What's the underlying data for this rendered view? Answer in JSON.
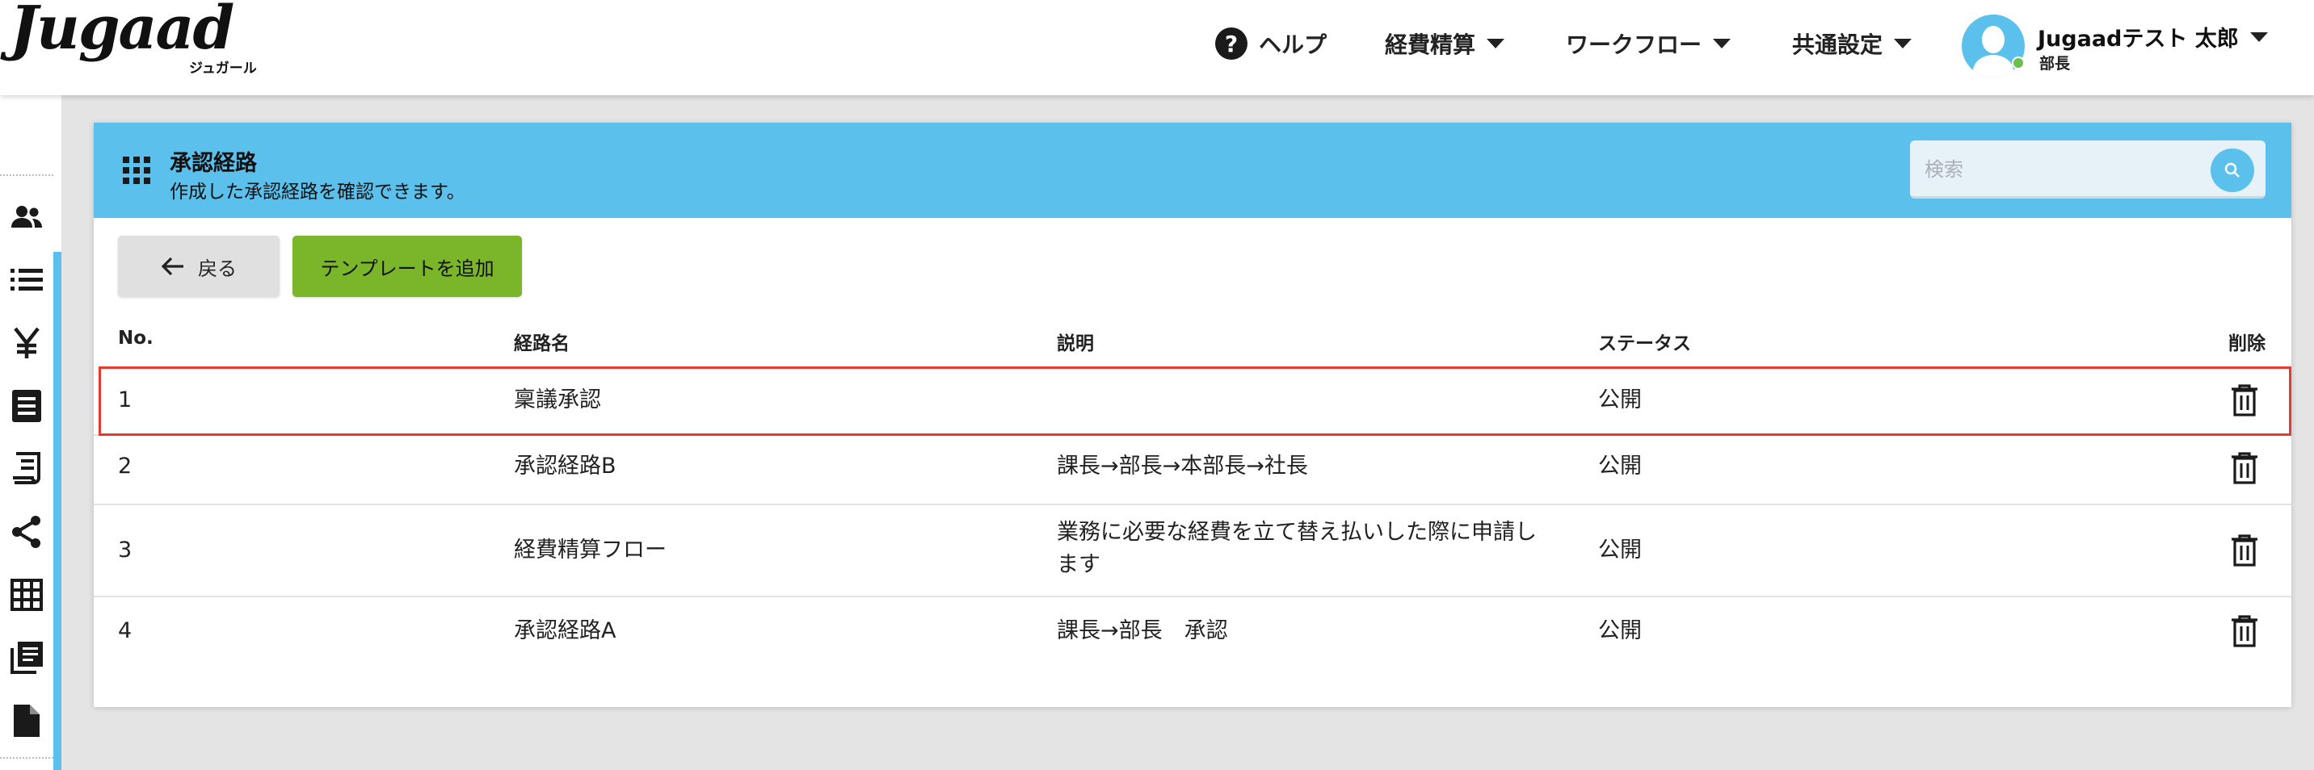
{
  "header": {
    "logo": "Jugaad",
    "logo_sub": "ジュガール",
    "nav": {
      "help": "ヘルプ",
      "expense": "経費精算",
      "workflow": "ワークフロー",
      "common_settings": "共通設定"
    },
    "user": {
      "name": "Jugaadテスト 太郎",
      "role": "部長"
    }
  },
  "sidebar": {
    "items": [
      "people-icon",
      "list-icon",
      "yen-icon",
      "document-lines-icon",
      "receipt-icon",
      "share-icon",
      "table-icon",
      "library-icon",
      "file-icon"
    ]
  },
  "panel": {
    "title": "承認経路",
    "subtitle": "作成した承認経路を確認できます。",
    "search_placeholder": "検索",
    "back_label": "戻る",
    "add_label": "テンプレートを追加"
  },
  "table": {
    "columns": {
      "no": "No.",
      "name": "経路名",
      "desc": "説明",
      "status": "ステータス",
      "delete": "削除"
    },
    "rows": [
      {
        "no": "1",
        "name": "稟議承認",
        "desc": "",
        "status": "公開"
      },
      {
        "no": "2",
        "name": "承認経路B",
        "desc": "課長→部長→本部長→社長",
        "status": "公開"
      },
      {
        "no": "3",
        "name": "経費精算フロー",
        "desc_line1": "業務に必要な経費を立て替え払いした際に申請し",
        "desc_line2": "ます",
        "status": "公開"
      },
      {
        "no": "4",
        "name": "承認経路A",
        "desc": "課長→部長　承認",
        "status": "公開"
      }
    ]
  },
  "colors": {
    "accent": "#5bc1ec",
    "add_button": "#7ab52a",
    "highlight": "#e53a2f"
  }
}
